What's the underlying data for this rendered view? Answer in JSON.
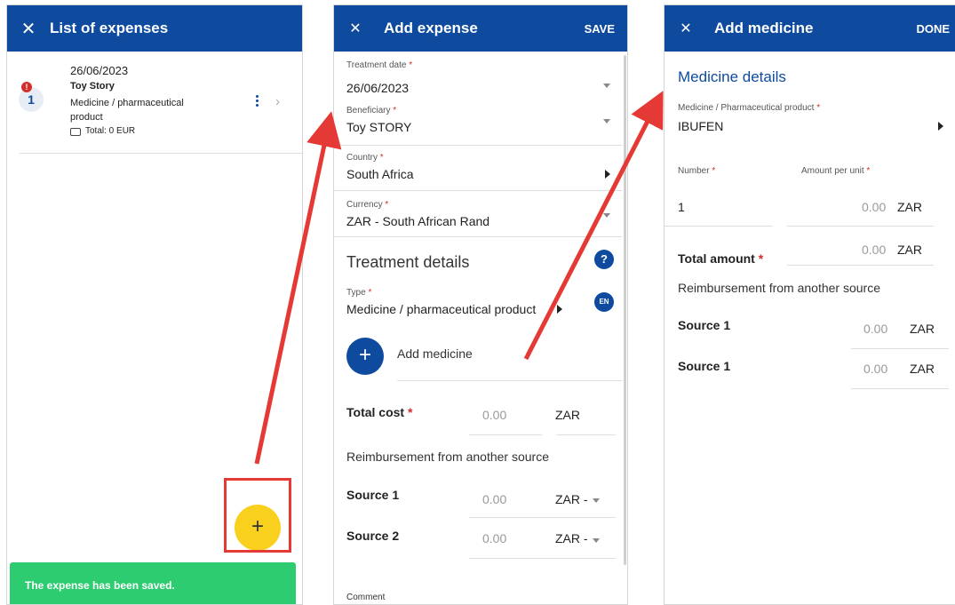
{
  "panel1": {
    "title": "List of expenses",
    "item": {
      "date": "26/06/2023",
      "name": "Toy Story",
      "type": "Medicine / pharmaceutical product",
      "total": "Total: 0 EUR",
      "index": "1",
      "alert": "!"
    },
    "fab": "+",
    "snackbar": "The expense has been saved."
  },
  "panel2": {
    "title": "Add expense",
    "save": "SAVE",
    "treatment_date_label": "Treatment date",
    "treatment_date": "26/06/2023",
    "beneficiary_label": "Beneficiary",
    "beneficiary": "Toy STORY",
    "country_label": "Country",
    "country": "South Africa",
    "currency_label": "Currency",
    "currency": "ZAR - South African Rand",
    "section": "Treatment details",
    "help": "?",
    "lang": "EN",
    "type_label": "Type",
    "type": "Medicine / pharmaceutical product",
    "add_medicine": "Add medicine",
    "total_cost_label": "Total cost",
    "total_cost": "0.00",
    "total_currency": "ZAR",
    "reimb": "Reimbursement from another source",
    "source1_label": "Source 1",
    "source1_value": "0.00",
    "source1_currency": "ZAR -",
    "source2_label": "Source 2",
    "source2_value": "0.00",
    "source2_currency": "ZAR -",
    "comment_label": "Comment",
    "asterisk": "*"
  },
  "panel3": {
    "title": "Add medicine",
    "done": "DONE",
    "section": "Medicine details",
    "product_label": "Medicine / Pharmaceutical product",
    "product": "IBUFEN",
    "number_label": "Number",
    "number": "1",
    "amount_label": "Amount per unit",
    "amount": "0.00",
    "amount_currency": "ZAR",
    "total_label": "Total amount",
    "total": "0.00",
    "total_currency": "ZAR",
    "reimb": "Reimbursement from another source",
    "source1_label": "Source 1",
    "source1_value": "0.00",
    "source1_currency": "ZAR",
    "source1b_label": "Source 1",
    "source1b_value": "0.00",
    "source1b_currency": "ZAR"
  },
  "colors": {
    "brand": "#0e4a9e",
    "fab": "#f9d01d",
    "snackbar": "#2ecc71",
    "highlight": "#e53935",
    "alert": "#d32f2f"
  }
}
